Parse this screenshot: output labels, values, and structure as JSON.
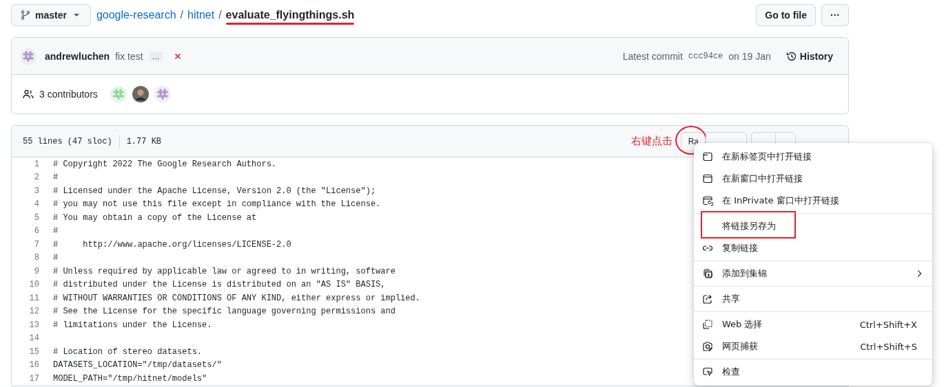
{
  "topbar": {
    "branch": "master",
    "breadcrumb": [
      {
        "text": "google-research",
        "kind": "link"
      },
      {
        "text": "/",
        "kind": "sep"
      },
      {
        "text": "hitnet",
        "kind": "link"
      },
      {
        "text": "/",
        "kind": "sep"
      },
      {
        "text": "evaluate_flyingthings.sh",
        "kind": "current",
        "underlined": true
      }
    ],
    "buttons": [
      "Go to file",
      "···"
    ]
  },
  "commit": {
    "author": "andrewluchen",
    "message": "fix test",
    "more": "…",
    "latest_label": "Latest commit",
    "sha": "ccc94ce",
    "date": "on 19 Jan",
    "history": "History"
  },
  "contributors": {
    "label": "3 contributors",
    "avatars": [
      {
        "kind": "identicon",
        "color": "#7ed98a"
      },
      {
        "kind": "photo"
      },
      {
        "kind": "identicon",
        "color": "#a98ad6"
      }
    ]
  },
  "file": {
    "lines": "55 lines (47 sloc)",
    "size": "1.77 KB",
    "note": "右键点击",
    "raw": {
      "label": "Ra",
      "circled": true
    },
    "code": [
      {
        "n": "1",
        "text": "# Copyright 2022 The Google Research Authors."
      },
      {
        "n": "2",
        "text": "#"
      },
      {
        "n": "3",
        "text": "# Licensed under the Apache License, Version 2.0 (the \"License\");"
      },
      {
        "n": "4",
        "text": "# you may not use this file except in compliance with the License."
      },
      {
        "n": "5",
        "text": "# You may obtain a copy of the License at"
      },
      {
        "n": "6",
        "text": "#"
      },
      {
        "n": "7",
        "text": "#     http://www.apache.org/licenses/LICENSE-2.0"
      },
      {
        "n": "8",
        "text": "#"
      },
      {
        "n": "9",
        "text": "# Unless required by applicable law or agreed to in writing, software"
      },
      {
        "n": "10",
        "text": "# distributed under the License is distributed on an \"AS IS\" BASIS,"
      },
      {
        "n": "11",
        "text": "# WITHOUT WARRANTIES OR CONDITIONS OF ANY KIND, either express or implied."
      },
      {
        "n": "12",
        "text": "# See the License for the specific language governing permissions and"
      },
      {
        "n": "13",
        "text": "# limitations under the License."
      },
      {
        "n": "14"
      },
      {
        "n": "15",
        "text": "# Location of stereo datasets."
      },
      {
        "n": "16",
        "text": "DATASETS_LOCATION=\"/tmp/datasets/\""
      },
      {
        "n": "17",
        "text": "MODEL_PATH=\"/tmp/hitnet/models\""
      }
    ]
  },
  "context_menu": {
    "groups": [
      [
        {
          "label": "在新标签页中打开链接"
        },
        {
          "label": "在新窗口中打开链接"
        },
        {
          "label": "在 InPrivate 窗口中打开链接"
        }
      ],
      [
        {
          "label": "将链接另存为",
          "highlighted": true
        },
        {
          "label": "复制链接"
        }
      ],
      [
        {
          "label": "添加到集锦",
          "submenu": true
        }
      ],
      [
        {
          "label": "共享"
        }
      ],
      [
        {
          "label": "Web 选择",
          "shortcut": "Ctrl+Shift+X"
        },
        {
          "label": "网页捕获",
          "shortcut": "Ctrl+Shift+S"
        }
      ],
      [
        {
          "label": "检查"
        }
      ]
    ]
  }
}
